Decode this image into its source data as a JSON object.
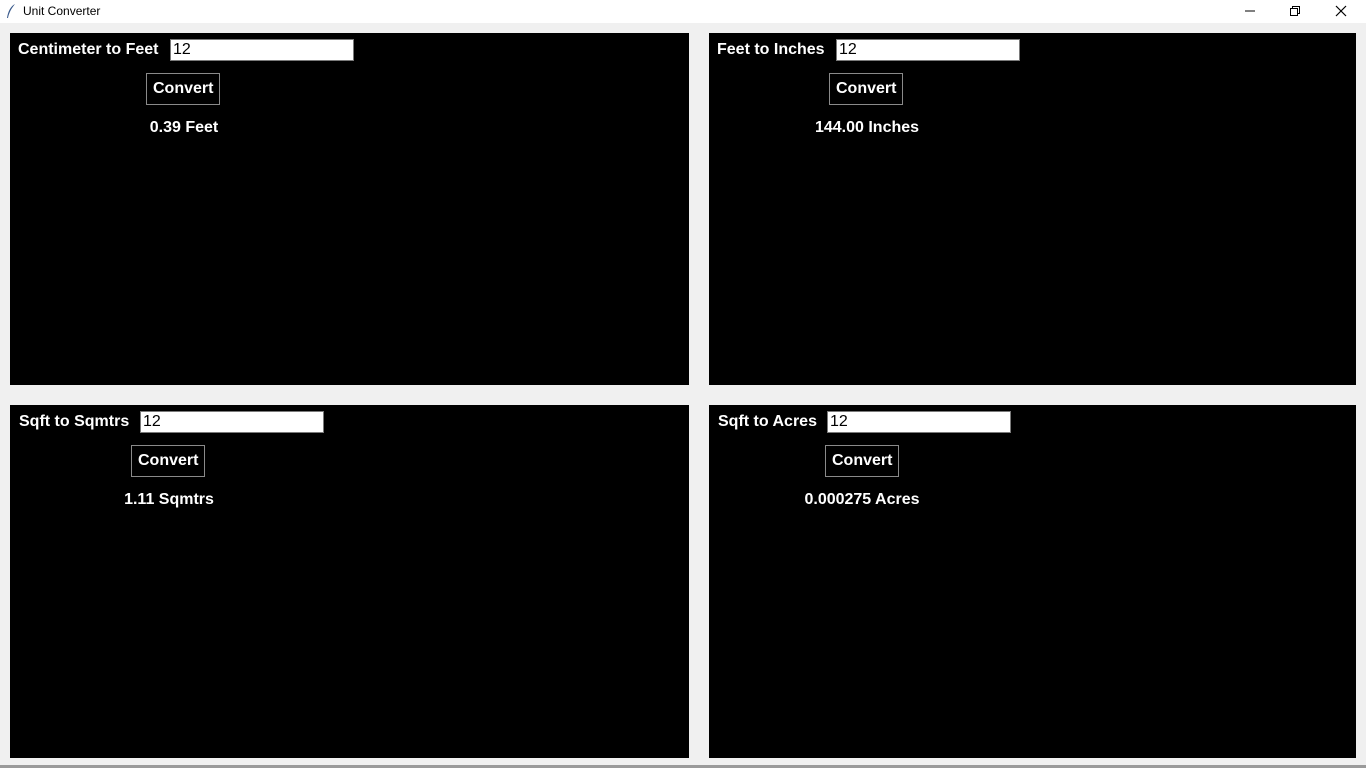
{
  "window": {
    "title": "Unit Converter"
  },
  "panels": [
    {
      "label": "Centimeter to Feet",
      "input_value": "12",
      "button_label": "Convert",
      "result": "0.39 Feet"
    },
    {
      "label": "Feet to Inches",
      "input_value": "12",
      "button_label": "Convert",
      "result": "144.00 Inches"
    },
    {
      "label": "Sqft to Sqmtrs",
      "input_value": "12",
      "button_label": "Convert",
      "result": "1.11 Sqmtrs"
    },
    {
      "label": "Sqft to Acres",
      "input_value": "12",
      "button_label": "Convert",
      "result": "0.000275 Acres"
    }
  ],
  "colors": {
    "panel_bg": "#000000",
    "text": "#ffffff",
    "window_bg": "#f0f0f0"
  }
}
